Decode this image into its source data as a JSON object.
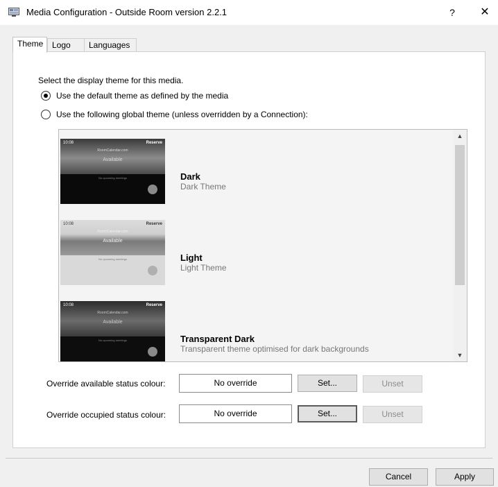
{
  "window": {
    "title": "Media Configuration - Outside Room version 2.2.1",
    "help_label": "?",
    "close_label": "✕",
    "icon": "window-app-icon"
  },
  "tabs": [
    {
      "label": "Theme",
      "active": true
    },
    {
      "label": "Logo",
      "active": false
    },
    {
      "label": "Languages",
      "active": false
    }
  ],
  "theme_page": {
    "intro": "Select the display theme for this media.",
    "options": [
      {
        "label": "Use the default theme as defined by the media",
        "selected": true
      },
      {
        "label": "Use the following global theme (unless overridden by a Connection):",
        "selected": false
      }
    ],
    "themes": [
      {
        "name": "Dark",
        "description": "Dark Theme",
        "style": "dark"
      },
      {
        "name": "Light",
        "description": "Light Theme",
        "style": "light"
      },
      {
        "name": "Transparent Dark",
        "description": "Transparent theme optimised for dark backgrounds",
        "style": "transparent-dark"
      }
    ],
    "preview": {
      "clock": "10:08",
      "reserve": "Reserve",
      "site": "RoomCalendar.com",
      "status": "Available",
      "no_meetings": "No upcoming meetings"
    },
    "overrides": [
      {
        "label": "Override available status colour:",
        "value": "No override",
        "set_label": "Set...",
        "unset_label": "Unset"
      },
      {
        "label": "Override occupied status colour:",
        "value": "No override",
        "set_label": "Set...",
        "unset_label": "Unset"
      }
    ]
  },
  "footer": {
    "cancel_label": "Cancel",
    "apply_label": "Apply"
  }
}
